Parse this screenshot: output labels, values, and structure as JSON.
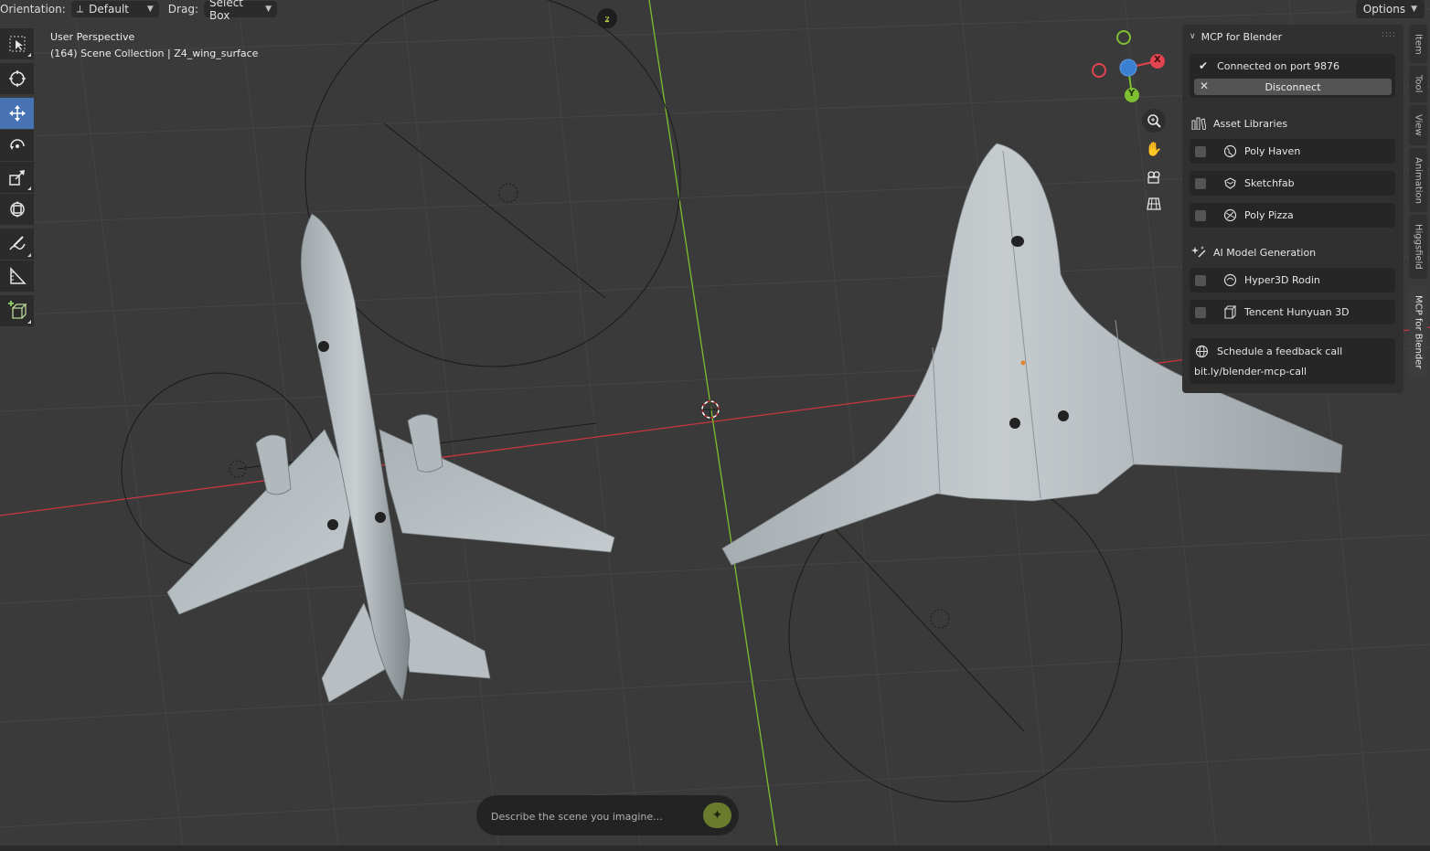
{
  "header": {
    "orientation_label": "Orientation:",
    "orientation_value": "Default",
    "drag_label": "Drag:",
    "drag_value": "Select Box",
    "options_label": "Options"
  },
  "viewport": {
    "view_name": "User Perspective",
    "collection_info": "(164) Scene Collection | Z4_wing_surface"
  },
  "toolbar": {
    "tools": [
      "select-box",
      "cursor",
      "move",
      "rotate",
      "scale",
      "transform",
      "annotate",
      "measure",
      "add-cube"
    ],
    "active_tool": "move"
  },
  "gizmo": {
    "x_label": "X",
    "y_label": "Y",
    "x_color": "#e24450",
    "y_color": "#7fbf32",
    "z_color": "#3b7fd1"
  },
  "panel": {
    "title": "MCP for Blender",
    "connection_status": "Connected on port 9876",
    "disconnect_label": "Disconnect",
    "asset_libraries_title": "Asset Libraries",
    "asset_libraries": [
      {
        "label": "Poly Haven",
        "icon": "globe-icon"
      },
      {
        "label": "Sketchfab",
        "icon": "sketchfab-icon"
      },
      {
        "label": "Poly Pizza",
        "icon": "polypizza-icon"
      }
    ],
    "ai_generation_title": "AI Model Generation",
    "ai_generators": [
      {
        "label": "Hyper3D Rodin",
        "icon": "hyper3d-icon"
      },
      {
        "label": "Tencent Hunyuan 3D",
        "icon": "cube-icon"
      }
    ],
    "feedback_label": "Schedule a feedback call",
    "feedback_link": "bit.ly/blender-mcp-call"
  },
  "sidebar_tabs": [
    {
      "label": "Item",
      "active": false
    },
    {
      "label": "Tool",
      "active": false
    },
    {
      "label": "View",
      "active": false
    },
    {
      "label": "Animation",
      "active": false
    },
    {
      "label": "Higgsfield",
      "active": false
    },
    {
      "label": "MCP for Blender",
      "active": true
    }
  ],
  "prompt": {
    "placeholder": "Describe the scene you imagine..."
  },
  "colors": {
    "x_axis": "#c8363f",
    "y_axis": "#7cbf2d",
    "active_tool": "#4772b3",
    "send_button": "#6b7b2d"
  }
}
